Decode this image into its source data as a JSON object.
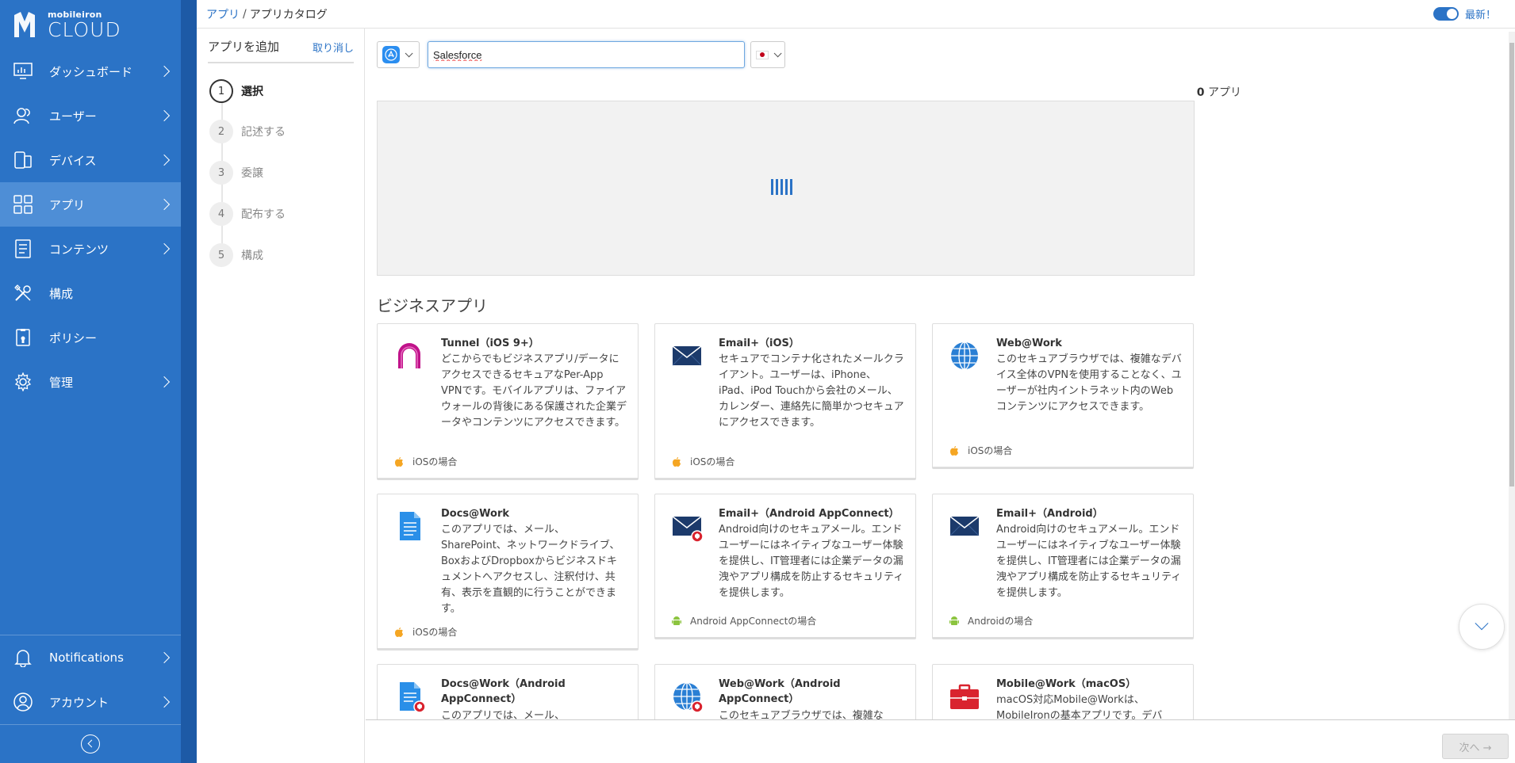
{
  "sidebar": {
    "logo_small": "mobileiron",
    "logo_big": "CLOUD",
    "items": [
      {
        "label": "ダッシュボード",
        "icon": "dashboard-icon"
      },
      {
        "label": "ユーザー",
        "icon": "users-icon"
      },
      {
        "label": "デバイス",
        "icon": "devices-icon"
      },
      {
        "label": "アプリ",
        "icon": "apps-icon",
        "active": true
      },
      {
        "label": "コンテンツ",
        "icon": "content-icon"
      },
      {
        "label": "構成",
        "icon": "configuration-icon"
      },
      {
        "label": "ポリシー",
        "icon": "policy-icon"
      },
      {
        "label": "管理",
        "icon": "admin-gear-icon"
      }
    ],
    "bottom_items": [
      {
        "label": "Notifications",
        "icon": "bell-icon"
      },
      {
        "label": "アカウント",
        "icon": "account-icon"
      }
    ]
  },
  "header": {
    "breadcrumb_link": "アプリ",
    "breadcrumb_sep": "/",
    "breadcrumb_current": "アプリカタログ",
    "toggle_label": "最新！"
  },
  "steps": {
    "title": "アプリを追加",
    "cancel": "取り消し",
    "items": [
      {
        "num": "1",
        "label": "選択"
      },
      {
        "num": "2",
        "label": "記述する"
      },
      {
        "num": "3",
        "label": "委譲"
      },
      {
        "num": "4",
        "label": "配布する"
      },
      {
        "num": "5",
        "label": "構成"
      }
    ]
  },
  "search": {
    "value": "Salesforce",
    "store_icon": "app-store-icon",
    "country": "Japan"
  },
  "results": {
    "count": "0",
    "count_label": "アプリ"
  },
  "section_title": "ビジネスアプリ",
  "cards": [
    {
      "title": "Tunnel（iOS 9+）",
      "desc": "どこからでもビジネスアプリ/データにアクセスできるセキュアなPer-App VPNです。モバイルアプリは、ファイアウォールの背後にある保護された企業データやコンテンツにアクセスできます。",
      "platform": "iOSの場合",
      "platform_icon": "apple-icon",
      "icon": "tunnel-icon"
    },
    {
      "title": "Email+（iOS）",
      "desc": "セキュアでコンテナ化されたメールクライアント。ユーザーは、iPhone、iPad、iPod Touchから会社のメール、カレンダー、連絡先に簡単かつセキュアにアクセスできます。",
      "platform": "iOSの場合",
      "platform_icon": "apple-icon",
      "icon": "email-icon"
    },
    {
      "title": "Web@Work",
      "desc": "このセキュアブラウザでは、複雑なデバイス全体のVPNを使用することなく、ユーザーが社内イントラネット内のWebコンテンツにアクセスできます。",
      "platform": "iOSの場合",
      "platform_icon": "apple-icon",
      "icon": "globe-icon"
    },
    {
      "title": "Docs@Work",
      "desc": "このアプリでは、メール、SharePoint、ネットワークドライブ、BoxおよびDropboxからビジネスドキュメントへアクセスし、注釈付け、共有、表示を直観的に行うことができます。",
      "platform": "iOSの場合",
      "platform_icon": "apple-icon",
      "icon": "document-icon"
    },
    {
      "title": "Email+（Android AppConnect）",
      "desc": "Android向けのセキュアメール。エンドユーザーにはネイティブなユーザー体験を提供し、IT管理者には企業データの漏洩やアプリ構成を防止するセキュリティを提供します。",
      "platform": "Android AppConnectの場合",
      "platform_icon": "android-icon",
      "icon": "email-appconnect-icon"
    },
    {
      "title": "Email+（Android）",
      "desc": "Android向けのセキュアメール。エンドユーザーにはネイティブなユーザー体験を提供し、IT管理者には企業データの漏洩やアプリ構成を防止するセキュリティを提供します。",
      "platform": "Androidの場合",
      "platform_icon": "android-icon",
      "icon": "email-icon"
    },
    {
      "title": "Docs@Work（Android AppConnect）",
      "desc": "このアプリでは、メール、",
      "platform": "",
      "platform_icon": "",
      "icon": "document-appconnect-icon"
    },
    {
      "title": "Web@Work（Android AppConnect）",
      "desc": "このセキュアブラウザでは、複雑な",
      "platform": "",
      "platform_icon": "",
      "icon": "globe-appconnect-icon"
    },
    {
      "title": "Mobile@Work（macOS）",
      "desc": "macOS対応Mobile@Workは、MobileIronの基本アプリです。デバ",
      "platform": "",
      "platform_icon": "",
      "icon": "briefcase-icon"
    }
  ],
  "footer": {
    "next": "次へ →"
  },
  "colors": {
    "sidebar": "#2b73c6",
    "accent": "#2b73c6",
    "tunnel": "#c0138a",
    "email": "#1c3a6b",
    "badge": "#d9232e",
    "android": "#8cc43f",
    "apple": "#f5a623"
  }
}
